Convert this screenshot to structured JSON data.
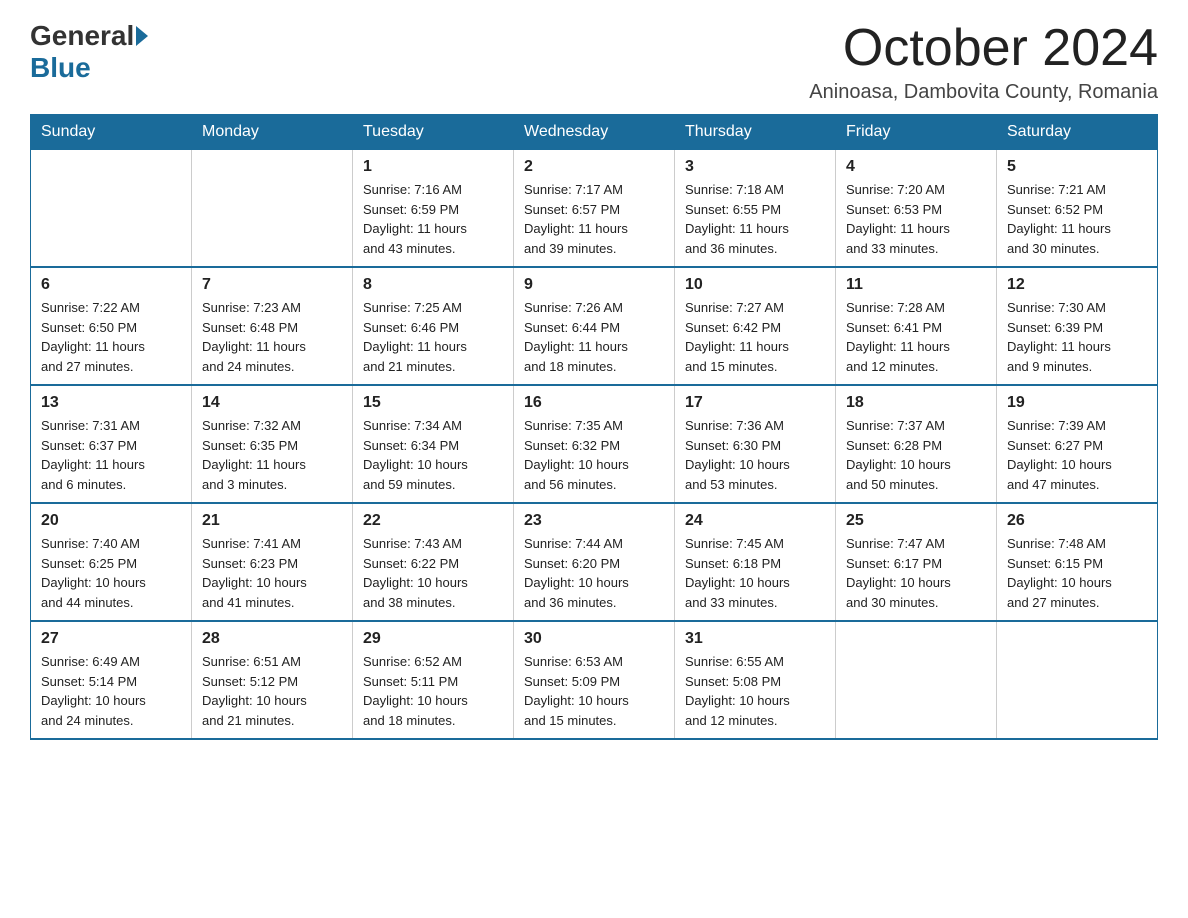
{
  "header": {
    "logo": {
      "general": "General",
      "blue": "Blue"
    },
    "title": "October 2024",
    "location": "Aninoasa, Dambovita County, Romania"
  },
  "calendar": {
    "days_of_week": [
      "Sunday",
      "Monday",
      "Tuesday",
      "Wednesday",
      "Thursday",
      "Friday",
      "Saturday"
    ],
    "weeks": [
      [
        {
          "day": "",
          "info": ""
        },
        {
          "day": "",
          "info": ""
        },
        {
          "day": "1",
          "info": "Sunrise: 7:16 AM\nSunset: 6:59 PM\nDaylight: 11 hours\nand 43 minutes."
        },
        {
          "day": "2",
          "info": "Sunrise: 7:17 AM\nSunset: 6:57 PM\nDaylight: 11 hours\nand 39 minutes."
        },
        {
          "day": "3",
          "info": "Sunrise: 7:18 AM\nSunset: 6:55 PM\nDaylight: 11 hours\nand 36 minutes."
        },
        {
          "day": "4",
          "info": "Sunrise: 7:20 AM\nSunset: 6:53 PM\nDaylight: 11 hours\nand 33 minutes."
        },
        {
          "day": "5",
          "info": "Sunrise: 7:21 AM\nSunset: 6:52 PM\nDaylight: 11 hours\nand 30 minutes."
        }
      ],
      [
        {
          "day": "6",
          "info": "Sunrise: 7:22 AM\nSunset: 6:50 PM\nDaylight: 11 hours\nand 27 minutes."
        },
        {
          "day": "7",
          "info": "Sunrise: 7:23 AM\nSunset: 6:48 PM\nDaylight: 11 hours\nand 24 minutes."
        },
        {
          "day": "8",
          "info": "Sunrise: 7:25 AM\nSunset: 6:46 PM\nDaylight: 11 hours\nand 21 minutes."
        },
        {
          "day": "9",
          "info": "Sunrise: 7:26 AM\nSunset: 6:44 PM\nDaylight: 11 hours\nand 18 minutes."
        },
        {
          "day": "10",
          "info": "Sunrise: 7:27 AM\nSunset: 6:42 PM\nDaylight: 11 hours\nand 15 minutes."
        },
        {
          "day": "11",
          "info": "Sunrise: 7:28 AM\nSunset: 6:41 PM\nDaylight: 11 hours\nand 12 minutes."
        },
        {
          "day": "12",
          "info": "Sunrise: 7:30 AM\nSunset: 6:39 PM\nDaylight: 11 hours\nand 9 minutes."
        }
      ],
      [
        {
          "day": "13",
          "info": "Sunrise: 7:31 AM\nSunset: 6:37 PM\nDaylight: 11 hours\nand 6 minutes."
        },
        {
          "day": "14",
          "info": "Sunrise: 7:32 AM\nSunset: 6:35 PM\nDaylight: 11 hours\nand 3 minutes."
        },
        {
          "day": "15",
          "info": "Sunrise: 7:34 AM\nSunset: 6:34 PM\nDaylight: 10 hours\nand 59 minutes."
        },
        {
          "day": "16",
          "info": "Sunrise: 7:35 AM\nSunset: 6:32 PM\nDaylight: 10 hours\nand 56 minutes."
        },
        {
          "day": "17",
          "info": "Sunrise: 7:36 AM\nSunset: 6:30 PM\nDaylight: 10 hours\nand 53 minutes."
        },
        {
          "day": "18",
          "info": "Sunrise: 7:37 AM\nSunset: 6:28 PM\nDaylight: 10 hours\nand 50 minutes."
        },
        {
          "day": "19",
          "info": "Sunrise: 7:39 AM\nSunset: 6:27 PM\nDaylight: 10 hours\nand 47 minutes."
        }
      ],
      [
        {
          "day": "20",
          "info": "Sunrise: 7:40 AM\nSunset: 6:25 PM\nDaylight: 10 hours\nand 44 minutes."
        },
        {
          "day": "21",
          "info": "Sunrise: 7:41 AM\nSunset: 6:23 PM\nDaylight: 10 hours\nand 41 minutes."
        },
        {
          "day": "22",
          "info": "Sunrise: 7:43 AM\nSunset: 6:22 PM\nDaylight: 10 hours\nand 38 minutes."
        },
        {
          "day": "23",
          "info": "Sunrise: 7:44 AM\nSunset: 6:20 PM\nDaylight: 10 hours\nand 36 minutes."
        },
        {
          "day": "24",
          "info": "Sunrise: 7:45 AM\nSunset: 6:18 PM\nDaylight: 10 hours\nand 33 minutes."
        },
        {
          "day": "25",
          "info": "Sunrise: 7:47 AM\nSunset: 6:17 PM\nDaylight: 10 hours\nand 30 minutes."
        },
        {
          "day": "26",
          "info": "Sunrise: 7:48 AM\nSunset: 6:15 PM\nDaylight: 10 hours\nand 27 minutes."
        }
      ],
      [
        {
          "day": "27",
          "info": "Sunrise: 6:49 AM\nSunset: 5:14 PM\nDaylight: 10 hours\nand 24 minutes."
        },
        {
          "day": "28",
          "info": "Sunrise: 6:51 AM\nSunset: 5:12 PM\nDaylight: 10 hours\nand 21 minutes."
        },
        {
          "day": "29",
          "info": "Sunrise: 6:52 AM\nSunset: 5:11 PM\nDaylight: 10 hours\nand 18 minutes."
        },
        {
          "day": "30",
          "info": "Sunrise: 6:53 AM\nSunset: 5:09 PM\nDaylight: 10 hours\nand 15 minutes."
        },
        {
          "day": "31",
          "info": "Sunrise: 6:55 AM\nSunset: 5:08 PM\nDaylight: 10 hours\nand 12 minutes."
        },
        {
          "day": "",
          "info": ""
        },
        {
          "day": "",
          "info": ""
        }
      ]
    ]
  }
}
